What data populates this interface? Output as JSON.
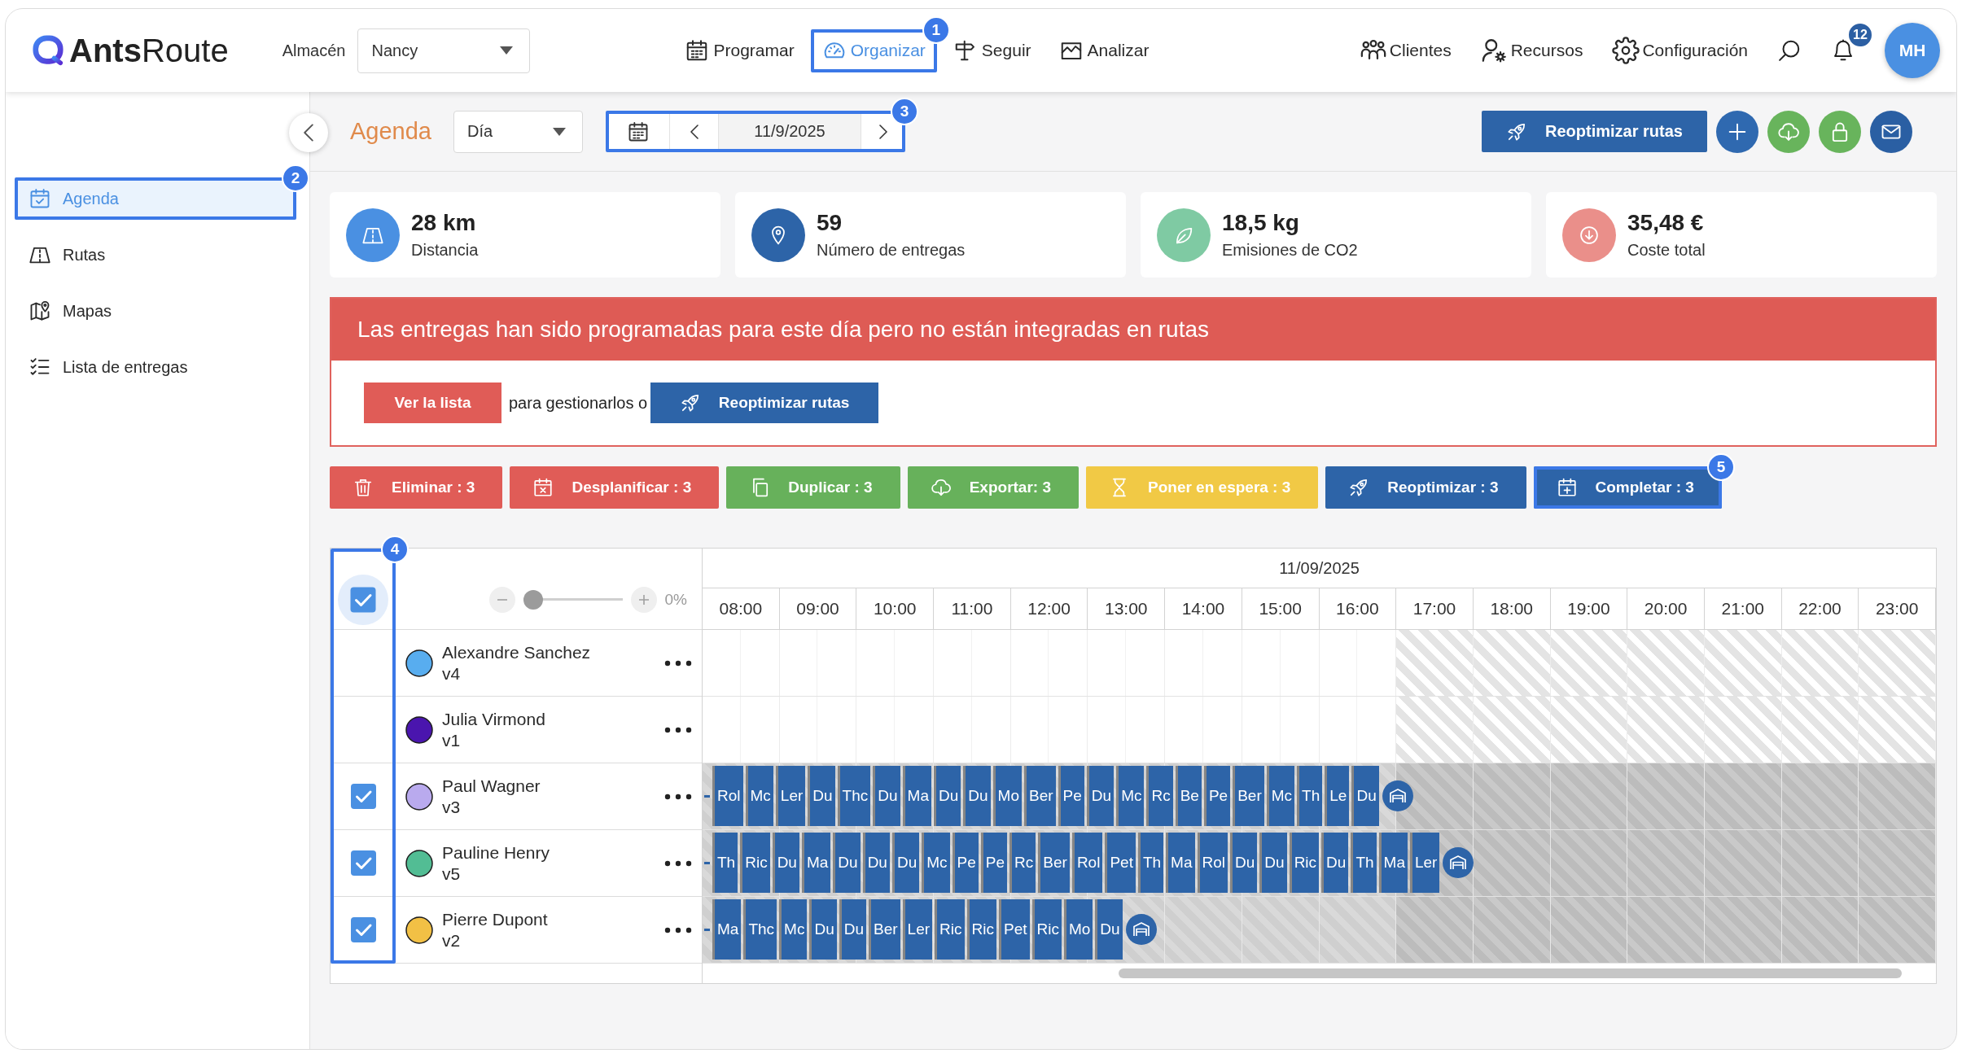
{
  "header": {
    "logo": "**Ants**Route",
    "warehouse": {
      "label": "Almacén",
      "value": "Nancy"
    },
    "nav": [
      {
        "label": "Programar",
        "selected": false
      },
      {
        "label": "Organizar",
        "selected": true,
        "callout": "1"
      },
      {
        "label": "Seguir",
        "selected": false
      },
      {
        "label": "Analizar",
        "selected": false
      }
    ],
    "tools": [
      "Clientes",
      "Recursos",
      "Configuración"
    ],
    "notification_count": "12",
    "avatar_initials": "MH"
  },
  "sidebar": {
    "items": [
      {
        "label": "Agenda",
        "selected": true,
        "callout": "2"
      },
      {
        "label": "Rutas",
        "selected": false
      },
      {
        "label": "Mapas",
        "selected": false
      },
      {
        "label": "Lista de entregas",
        "selected": false
      }
    ]
  },
  "toolbar": {
    "title": "Agenda",
    "view": "Día",
    "date": "11/9/2025",
    "date_callout": "3",
    "primary_button": "Reoptimizar rutas"
  },
  "stats": [
    {
      "value": "28 km",
      "label": "Distancia",
      "color": "#4a90e2"
    },
    {
      "value": "59",
      "label": "Número de entregas",
      "color": "#2d64a8"
    },
    {
      "value": "18,5 kg",
      "label": "Emisiones de CO2",
      "color": "#7fcaa3"
    },
    {
      "value": "35,48 €",
      "label": "Coste total",
      "color": "#ea8f8a"
    }
  ],
  "alert": {
    "message": "Las entregas han sido programadas para este día pero no están integradas en rutas",
    "list_button": "Ver la lista",
    "connector": "para gestionarlos o",
    "optimize_button": "Reoptimizar rutas"
  },
  "actions": [
    {
      "label": "Eliminar : 3",
      "color": "#e05c57"
    },
    {
      "label": "Desplanificar : 3",
      "color": "#e05c57"
    },
    {
      "label": "Duplicar : 3",
      "color": "#67b15b"
    },
    {
      "label": "Exportar: 3",
      "color": "#67b15b"
    },
    {
      "label": "Poner en espera : 3",
      "color": "#f1c945"
    },
    {
      "label": "Reoptimizar : 3",
      "color": "#2d64a8"
    },
    {
      "label": "Completar : 3",
      "color": "#2d64a8",
      "callout": "5"
    }
  ],
  "gantt": {
    "checkbox_callout": "4",
    "select_all": {
      "checked": true
    },
    "zoom": {
      "level": 0,
      "reading": "0%"
    },
    "date": "11/09/2025",
    "hours": [
      {
        "label": "08:00",
        "off": false
      },
      {
        "label": "09:00",
        "off": false
      },
      {
        "label": "10:00",
        "off": false
      },
      {
        "label": "11:00",
        "off": false
      },
      {
        "label": "12:00",
        "off": false
      },
      {
        "label": "13:00",
        "off": false
      },
      {
        "label": "14:00",
        "off": false
      },
      {
        "label": "15:00",
        "off": false
      },
      {
        "label": "16:00",
        "off": false
      },
      {
        "label": "17:00",
        "off": true
      },
      {
        "label": "18:00",
        "off": true
      },
      {
        "label": "19:00",
        "off": true
      },
      {
        "label": "20:00",
        "off": true
      },
      {
        "label": "21:00",
        "off": true
      },
      {
        "label": "22:00",
        "off": true
      },
      {
        "label": "23:00",
        "off": true
      }
    ],
    "rows": [
      {
        "name": "Alexandre Sanchez",
        "vehicle": "v4",
        "color": "#58adef",
        "checked": false
      },
      {
        "name": "Julia Virmond",
        "vehicle": "v1",
        "color": "#4a15ae",
        "checked": false
      },
      {
        "name": "Paul Wagner",
        "vehicle": "v3",
        "color": "#b9aaee",
        "checked": true,
        "tasks": [
          "Rol",
          "Mc",
          "Ler",
          "Du",
          "Thc",
          "Du",
          "Ma",
          "Du",
          "Du",
          "Mo",
          "Ber",
          "Pe",
          "Du",
          "Mc",
          "Rc",
          "Be",
          "Pe",
          "Ber",
          "Mc",
          "Th",
          "Le",
          "Du"
        ]
      },
      {
        "name": "Pauline Henry",
        "vehicle": "v5",
        "color": "#52bd94",
        "checked": true,
        "tasks": [
          "Th",
          "Ric",
          "Du",
          "Ma",
          "Du",
          "Du",
          "Du",
          "Mc",
          "Pe",
          "Pe",
          "Rc",
          "Ber",
          "Rol",
          "Pet",
          "Th",
          "Ma",
          "Rol",
          "Du",
          "Du",
          "Ric",
          "Du",
          "Th",
          "Ma",
          "Ler"
        ]
      },
      {
        "name": "Pierre Dupont",
        "vehicle": "v2",
        "color": "#f2c045",
        "checked": true,
        "tasks": [
          "Ma",
          "Thc",
          "Mc",
          "Du",
          "Du",
          "Ber",
          "Ler",
          "Ric",
          "Ric",
          "Pet",
          "Ric",
          "Mo",
          "Du"
        ]
      }
    ]
  }
}
